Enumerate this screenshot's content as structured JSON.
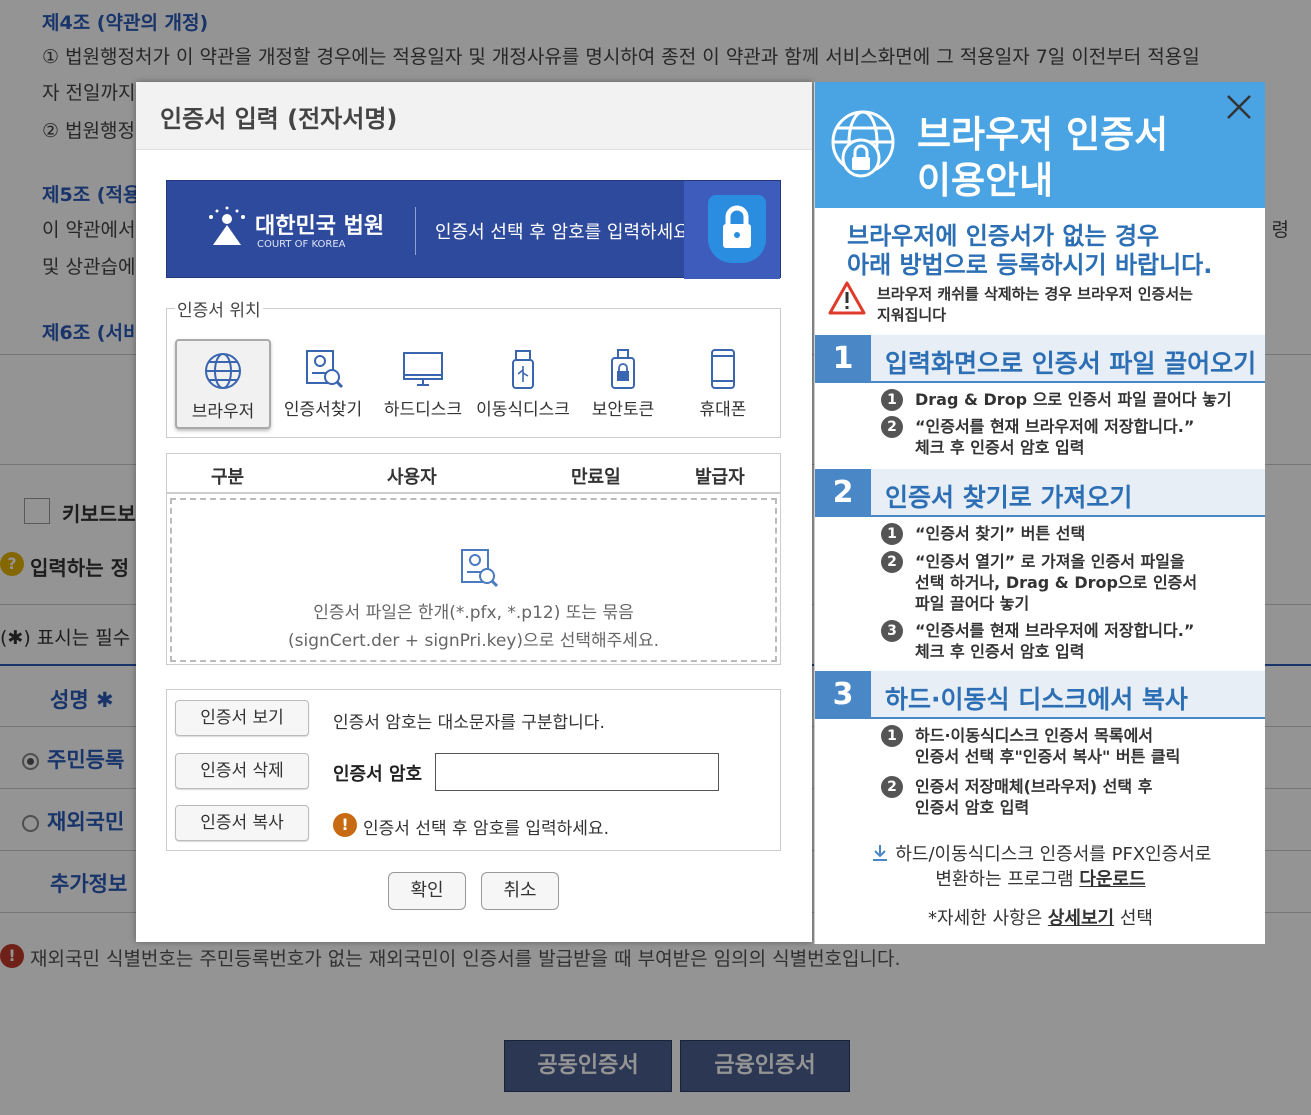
{
  "background": {
    "articles": [
      {
        "title": "제4조 (약관의 개정)",
        "lines": [
          "① 법원행정처가 이 약관을 개정할 경우에는 적용일자 및 개정사유를 명시하여 종전 이 약관과 함께 서비스화면에 그 적용일자 7일 이전부터 적용일",
          "자 전일까지",
          "② 법원행정"
        ]
      },
      {
        "title": "제5조 (적용",
        "lines": [
          "이 약관에서",
          "및 상관습에"
        ]
      },
      {
        "title": "제6조 (서비"
      }
    ],
    "right_fragment": "령",
    "keyboard_label": "키보드보",
    "info_label": "입력하는 정",
    "required_note": "(✱) 표시는 필수",
    "form": {
      "name_label": "성명 ✱",
      "radio_resident": "주민등록",
      "radio_foreign": "재외국민",
      "extra_label": "추가정보"
    },
    "footer_note": "재외국민 식별번호는 주민등록번호가 없는 재외국민이 인증서를 발급받을 때 부여받은 임의의 식별번호입니다.",
    "buttons": {
      "joint": "공동인증서",
      "financial": "금융인증서"
    }
  },
  "dialog": {
    "title": "인증서 입력 (전자서명)",
    "banner": {
      "court_ko": "대한민국 법원",
      "court_en": "COURT OF KOREA",
      "hint": "인증서 선택 후 암호를 입력하세요."
    },
    "location": {
      "legend": "인증서 위치",
      "items": [
        {
          "label": "브라우저",
          "icon": "globe-icon",
          "selected": true
        },
        {
          "label": "인증서찾기",
          "icon": "cert-search-icon"
        },
        {
          "label": "하드디스크",
          "icon": "monitor-icon"
        },
        {
          "label": "이동식디스크",
          "icon": "usb-icon"
        },
        {
          "label": "보안토큰",
          "icon": "security-token-icon"
        },
        {
          "label": "휴대폰",
          "icon": "phone-icon"
        }
      ]
    },
    "table": {
      "columns": [
        "구분",
        "사용자",
        "만료일",
        "발급자"
      ],
      "empty_line1": "인증서 파일은 한개(*.pfx, *.p12) 또는 묶음",
      "empty_line2": "(signCert.der + signPri.key)으로 선택해주세요."
    },
    "password_area": {
      "view_button": "인증서 보기",
      "delete_button": "인증서 삭제",
      "copy_button": "인증서 복사",
      "case_note": "인증서 암호는 대소문자를 구분합니다.",
      "password_label": "인증서 암호",
      "password_value": "",
      "hint": "인증서 선택 후 암호를 입력하세요."
    },
    "confirm_button": "확인",
    "cancel_button": "취소"
  },
  "guide": {
    "title_line1": "브라우저 인증서",
    "title_line2": "이용안내",
    "intro_line1": "브라우저에 인증서가 없는 경우",
    "intro_line2": "아래 방법으로 등록하시기 바랍니다.",
    "warning_line1": "브라우저 캐쉬를 삭제하는 경우 브라우저 인증서는",
    "warning_line2": "지워집니다",
    "steps": [
      {
        "num": "1",
        "title": "입력화면으로 인증서 파일 끌어오기",
        "items": [
          {
            "n": "1",
            "lines": [
              "Drag & Drop 으로 인증서 파일 끌어다 놓기"
            ]
          },
          {
            "n": "2",
            "lines": [
              "“인증서를 현재 브라우저에 저장합니다.”",
              "체크 후 인증서 암호 입력"
            ]
          }
        ]
      },
      {
        "num": "2",
        "title": "인증서 찾기로 가져오기",
        "items": [
          {
            "n": "1",
            "lines": [
              "“인증서 찾기” 버튼 선택"
            ]
          },
          {
            "n": "2",
            "lines": [
              "“인증서 열기” 로 가져올 인증서 파일을",
              "선택 하거나, Drag & Drop으로 인증서",
              "파일 끌어다 놓기"
            ]
          },
          {
            "n": "3",
            "lines": [
              "“인증서를 현재 브라우저에 저장합니다.”",
              "체크 후 인증서 암호 입력"
            ]
          }
        ]
      },
      {
        "num": "3",
        "title": "하드·이동식 디스크에서 복사",
        "items": [
          {
            "n": "1",
            "lines": [
              "하드·이동식디스크 인증서 목록에서",
              "인증서 선택 후\"인증서 복사\" 버튼 클릭"
            ]
          },
          {
            "n": "2",
            "lines": [
              "인증서 저장매체(브라우저) 선택 후",
              "인증서 암호 입력"
            ]
          }
        ]
      }
    ],
    "download_line1": "하드/이동식디스크 인증서를 PFX인증서로",
    "download_line2_prefix": "변환하는 프로그램 ",
    "download_link": "다운로드",
    "more_prefix": "*자세한 사항은 ",
    "more_link": "상세보기",
    "more_suffix": " 선택"
  }
}
